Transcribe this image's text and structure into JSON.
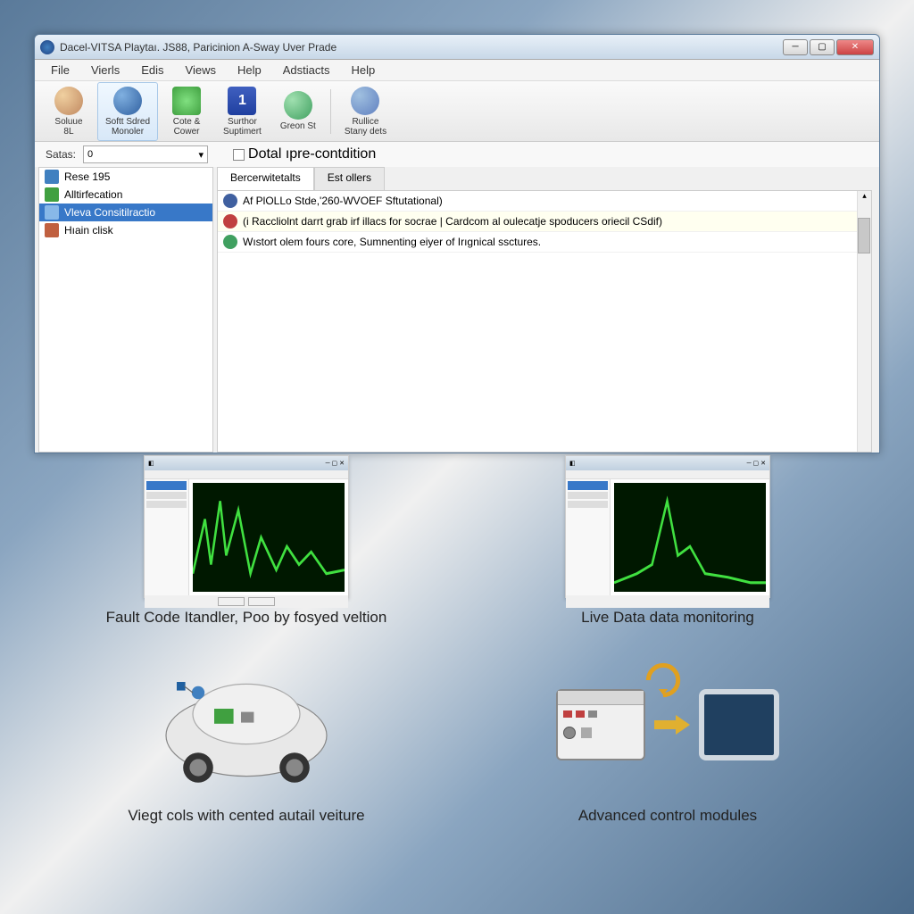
{
  "window": {
    "title": "Dacel-VITSA Playtaı. JS88, Paricinion A-Sway Uver Prade"
  },
  "menubar": [
    "File",
    "Vierls",
    "Edis",
    "Views",
    "Help",
    "Adstiacts",
    "Help"
  ],
  "toolbar": [
    {
      "label": "Soluue\n8L",
      "color": "#c08860"
    },
    {
      "label": "Softt Sdred\nMonoler",
      "color": "#3060a0"
    },
    {
      "label": "Cote &\nCower",
      "color": "#40a040"
    },
    {
      "label": "Surthor\nSuptimert",
      "color": "#2040a0"
    },
    {
      "label": "Greon St",
      "color": "#40a060"
    },
    {
      "label": "Rullice\nStany dets",
      "color": "#6080c0"
    }
  ],
  "controls": {
    "satas_label": "Satas:",
    "satas_value": "0",
    "checkbox_label": "Dotal ıpre-contdition"
  },
  "sidebar": {
    "items": [
      {
        "label": "Rese 195",
        "color": "#4080c0"
      },
      {
        "label": "Alltirfecation",
        "color": "#40a040"
      },
      {
        "label": "Vleva Consitilractio",
        "color": "#4080c0",
        "selected": true
      },
      {
        "label": "Hıain clisk",
        "color": "#c06040"
      }
    ]
  },
  "tabs": [
    "Bercerwitetalts",
    "Est ollers"
  ],
  "list": [
    {
      "text": "Af PlOLLo Stde,'260-WVOEF Sftutational)",
      "color": "#4060a0"
    },
    {
      "text": "(i Raccliolnt darrt grab irf illacs for socrae | Cardcom al oulecatje spoducers oriecil CSdif)",
      "color": "#c04040",
      "highlighted": true
    },
    {
      "text": "Wıstort olem fours core, Sumnenting eiyer of Irıgnical ssctures.",
      "color": "#40a060"
    }
  ],
  "features": [
    {
      "label": "Fault Code Itandler, Poo by fosyed veltion"
    },
    {
      "label": "Live Data data monitoring"
    },
    {
      "label": "Viegt cols with cented autail veiture"
    },
    {
      "label": "Advanced control modules"
    }
  ]
}
